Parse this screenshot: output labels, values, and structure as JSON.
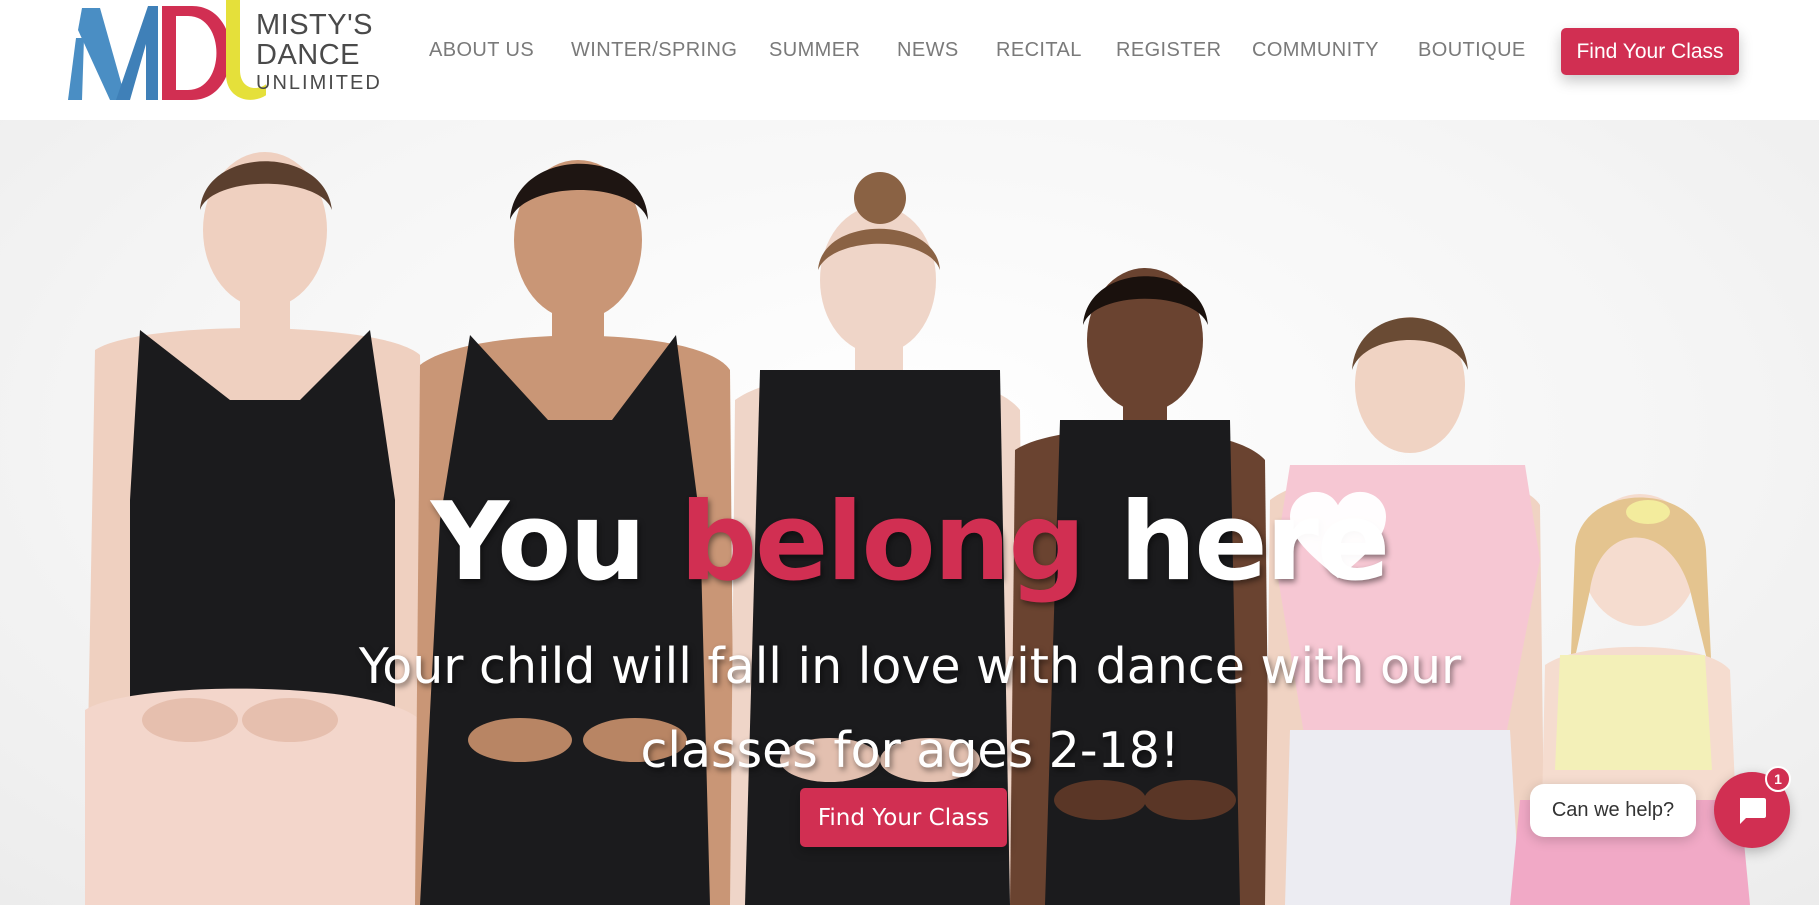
{
  "brand": {
    "monogram": "MDU",
    "name_line1": "MISTY'S",
    "name_line2": "DANCE",
    "name_line3": "UNLIMITED",
    "colors": {
      "blue": "#4a8ec4",
      "red": "#d12f52",
      "yellow": "#e5e03a"
    }
  },
  "nav": {
    "items": [
      {
        "label": "ABOUT US"
      },
      {
        "label": "WINTER/SPRING"
      },
      {
        "label": "SUMMER"
      },
      {
        "label": "NEWS"
      },
      {
        "label": "RECITAL"
      },
      {
        "label": "REGISTER"
      },
      {
        "label": "COMMUNITY"
      },
      {
        "label": "BOUTIQUE"
      }
    ],
    "cta_label": "Find Your Class"
  },
  "hero": {
    "heading_before": "You",
    "heading_accent": "belong",
    "heading_after": "here",
    "heart_icon": "heart-icon",
    "subtitle": "Your child will fall in love with dance with our classes for ages 2-18!",
    "cta_label": "Find Your Class"
  },
  "chat": {
    "prompt": "Can we help?",
    "badge_count": "1",
    "icon": "chat-icon"
  },
  "theme": {
    "accent": "#d12f52",
    "nav_text": "#7a7a7a",
    "leotard": "#1b1b1d",
    "skin_light": "#efd0c0",
    "skin_dark": "#6a4330",
    "pink_leotard": "#f6c7d3"
  }
}
